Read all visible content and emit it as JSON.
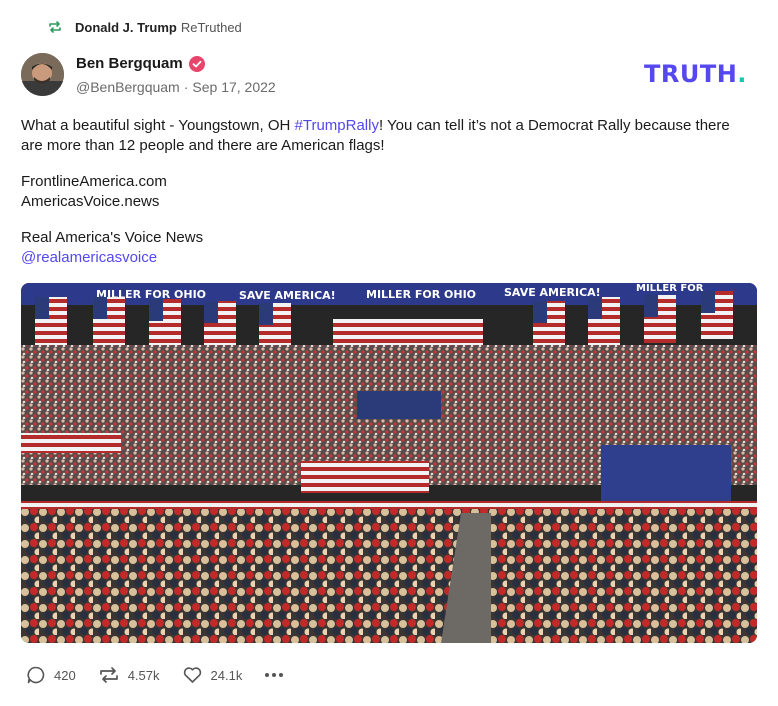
{
  "retruth": {
    "user": "Donald J. Trump",
    "action": "ReTruthed",
    "icon": "retruth-icon"
  },
  "author": {
    "name": "Ben Bergquam",
    "handle": "@BenBergquam",
    "date": "Sep 17, 2022",
    "verified_icon": "verified-badge-icon"
  },
  "brand": {
    "text": "TRUTH",
    "dot": ".",
    "color": "#5448ee",
    "dot_color": "#11c8b0"
  },
  "post": {
    "line1_pre": "What a beautiful sight - Youngstown, OH ",
    "line1_tag": "#TrumpRally",
    "line1_post": "! You can tell it’s not a Democrat Rally because there are more than 12 people and there are American flags!",
    "link1": "FrontlineAmerica.com",
    "link2": "AmericasVoice.news",
    "source": "Real America's Voice News",
    "mention": "@realamericasvoice"
  },
  "media": {
    "banner_texts": [
      "MILLER FOR OHIO",
      "SAVE AMERICA!",
      "MILLER FOR OHIO",
      "SAVE AMERICA!",
      "MILLER FOR"
    ]
  },
  "actions": {
    "replies": "420",
    "retruths": "4.57k",
    "likes": "24.1k",
    "more_icon": "more-dots-icon"
  }
}
